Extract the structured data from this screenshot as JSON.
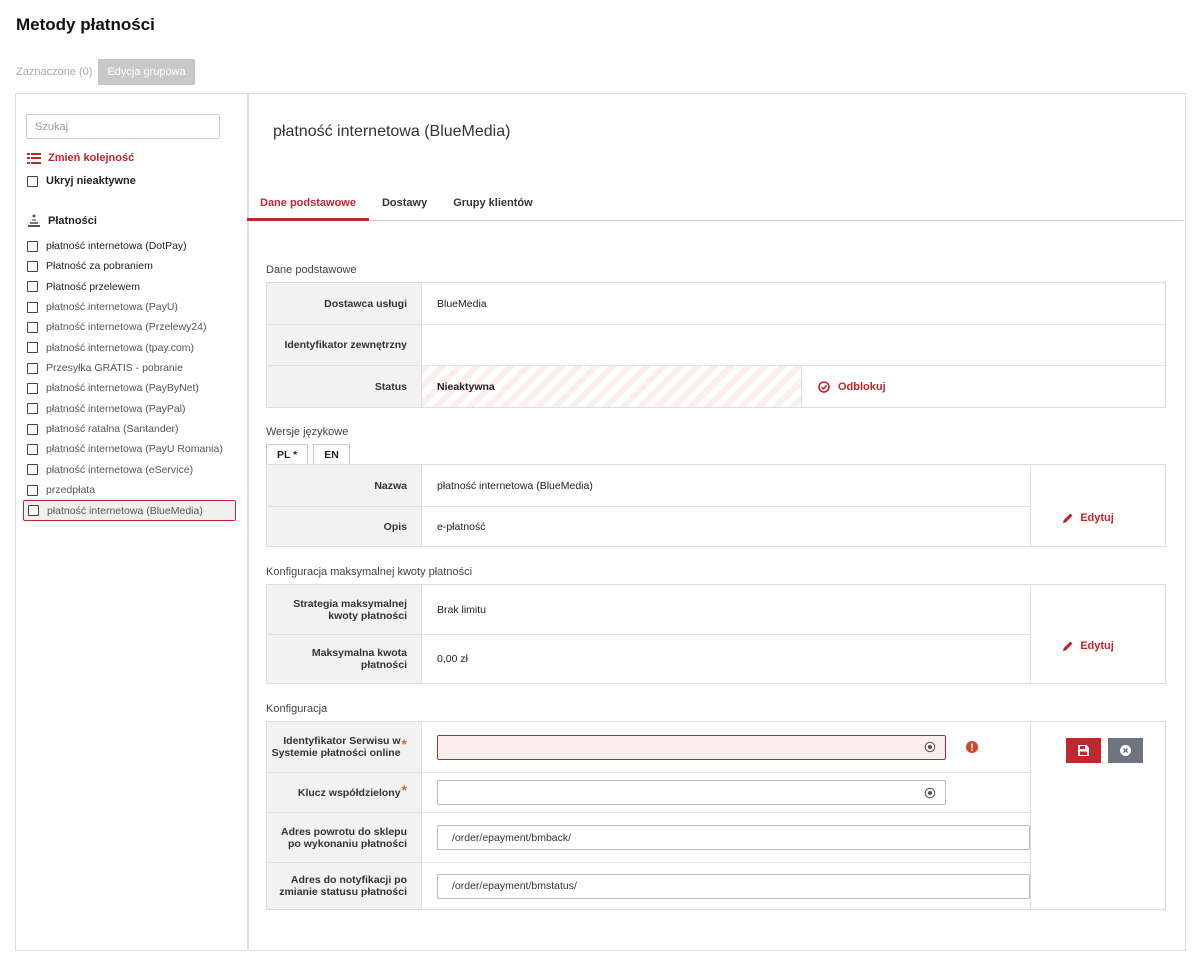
{
  "page": {
    "title": "Metody płatności"
  },
  "toolbar": {
    "selected_label": "Zaznaczone (0)",
    "group_edit_label": "Edycja grupowa"
  },
  "sidebar": {
    "search_placeholder": "Szukaj",
    "reorder_label": "Zmień kolejność",
    "hide_inactive_label": "Ukryj nieaktywne",
    "section_label": "Płatności",
    "methods": [
      "płatność internetowa (DotPay)",
      "Płatność za pobraniem",
      "Płatność przelewem",
      "płatność internetowa (PayU)",
      "płatność internetowa (Przelewy24)",
      "płatność internetowa (tpay.com)",
      "Przesyłka GRATIS - pobranie",
      "płatność internetowa (PayByNet)",
      "płatność internetowa (PayPal)",
      "płatność ratalna (Santander)",
      "płatność internetowa (PayU Romania)",
      "płatność internetowa (eService)",
      "przedpłata",
      "płatność internetowa (BlueMedia)"
    ]
  },
  "detail": {
    "title": "płatność internetowa (BlueMedia)",
    "tabs": [
      "Dane podstawowe",
      "Dostawy",
      "Grupy klientów"
    ],
    "basic": {
      "section_label": "Dane podstawowe",
      "provider_label": "Dostawca usługi",
      "provider_value": "BlueMedia",
      "external_id_label": "Identyfikator zewnętrzny",
      "external_id_value": "",
      "status_label": "Status",
      "status_value": "Nieaktywna",
      "unlock_label": "Odblokuj"
    },
    "lang": {
      "section_label": "Wersje językowe",
      "tabs": [
        "PL *",
        "EN"
      ],
      "name_label": "Nazwa",
      "name_value": "płatność internetowa (BlueMedia)",
      "desc_label": "Opis",
      "desc_value": "e-płatność",
      "edit_label": "Edytuj"
    },
    "max_amount": {
      "section_label": "Konfiguracja maksymalnej kwoty płatności",
      "strategy_label": "Strategia maksymalnej kwoty płatności",
      "strategy_value": "Brak limitu",
      "amount_label": "Maksymalna kwota płatności",
      "amount_value": "0,00 zł",
      "edit_label": "Edytuj"
    },
    "config": {
      "section_label": "Konfiguracja",
      "service_id_label": "Identyfikator Serwisu w Systemie płatności online",
      "service_id_value": "",
      "shared_key_label": "Klucz współdzielony",
      "shared_key_value": "",
      "return_url_label": "Adres powrotu do sklepu po wykonaniu płatności",
      "return_url_value": "/order/epayment/bmback/",
      "notify_url_label": "Adres do notyfikacji po zmianie statusu płatności",
      "notify_url_value": "/order/epayment/bmstatus/",
      "required_mark": "*"
    }
  },
  "colors": {
    "accent": "#c0262d",
    "muted_button": "#6b747f",
    "required": "#e06b2e"
  }
}
